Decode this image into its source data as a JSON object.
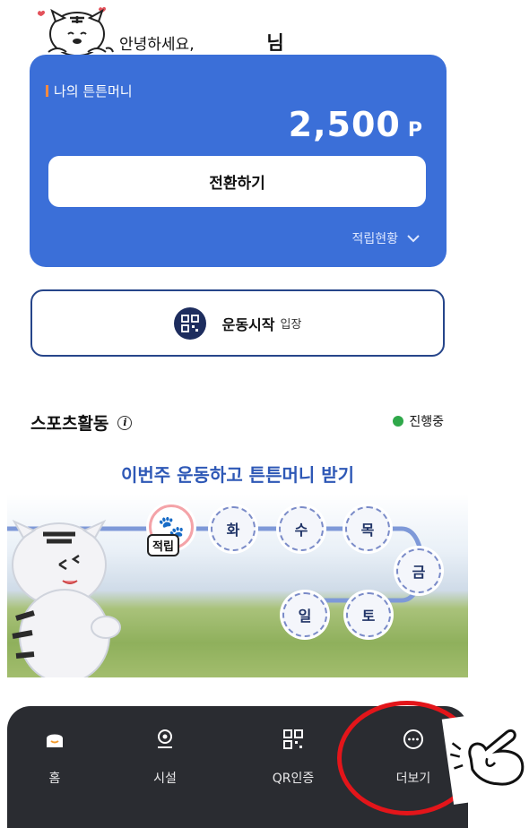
{
  "greeting": {
    "text": "안녕하세요,",
    "suffix": "님"
  },
  "money_card": {
    "title": "나의 튼튼머니",
    "amount": "2,500",
    "unit": "P",
    "convert_button": "전환하기",
    "accumulation_link": "적립현황"
  },
  "start_exercise": {
    "label": "운동시작",
    "sub_label": "입장"
  },
  "sports": {
    "title": "스포츠활동",
    "status": "진행중",
    "status_color": "#2fa84a",
    "banner_title": "이번주 운동하고 튼튼머니 받기",
    "stamp_label": "적립",
    "days": [
      "화",
      "수",
      "목",
      "금",
      "토",
      "일"
    ]
  },
  "bottom_nav": {
    "items": [
      {
        "label": "홈",
        "icon": "home-icon"
      },
      {
        "label": "시설",
        "icon": "location-pin-icon"
      },
      {
        "label": "QR인증",
        "icon": "qr-code-icon"
      },
      {
        "label": "더보기",
        "icon": "more-icon"
      }
    ]
  },
  "colors": {
    "card_blue": "#3b6fd8",
    "nav_dark": "#2a2c31",
    "highlight_red": "#e3151a"
  }
}
